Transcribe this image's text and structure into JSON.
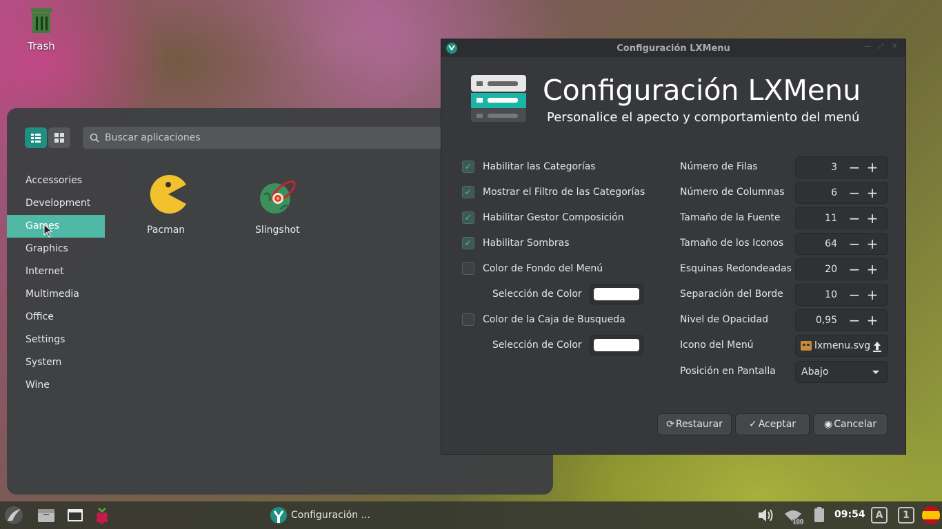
{
  "desktop": {
    "trash_label": "Trash"
  },
  "menu": {
    "search_placeholder": "Buscar aplicaciones",
    "categories": [
      "Accessories",
      "Development",
      "Games",
      "Graphics",
      "Internet",
      "Multimedia",
      "Office",
      "Settings",
      "System",
      "Wine"
    ],
    "active_category": "Games",
    "apps": [
      {
        "label": "Pacman",
        "icon": "pacman-icon"
      },
      {
        "label": "Slingshot",
        "icon": "slingshot-icon"
      }
    ]
  },
  "config_window": {
    "title": "Configuración LXMenu",
    "header_title": "Configuración LXMenu",
    "header_subtitle": "Personalice el apecto y comportamiento del menú",
    "checkboxes": [
      {
        "label": "Habilitar las Categorías",
        "checked": true
      },
      {
        "label": "Mostrar el Filtro de las Categorías",
        "checked": true
      },
      {
        "label": "Habilitar Gestor Composición",
        "checked": true
      },
      {
        "label": "Habilitar Sombras",
        "checked": true
      },
      {
        "label": "Color de Fondo del Menú",
        "checked": false
      },
      {
        "label": "Color de la Caja de Busqueda",
        "checked": false
      }
    ],
    "color_selection_label": "Selección de Color",
    "fields": [
      {
        "label": "Número de Filas",
        "value": "3"
      },
      {
        "label": "Número de Columnas",
        "value": "6"
      },
      {
        "label": "Tamaño de la Fuente",
        "value": "11"
      },
      {
        "label": "Tamaño de los Iconos",
        "value": "64"
      },
      {
        "label": "Esquinas Redondeadas",
        "value": "20"
      },
      {
        "label": "Separación del Borde",
        "value": "10"
      },
      {
        "label": "Nivel de Opacidad",
        "value": "0,95"
      }
    ],
    "menu_icon_label": "Icono del Menú",
    "menu_icon_file": "lxmenu.svg",
    "screen_position_label": "Posición en Pantalla",
    "screen_position_value": "Abajo",
    "buttons": {
      "restore": "Restaurar",
      "accept": "Aceptar",
      "cancel": "Cancelar"
    }
  },
  "taskbar": {
    "task_label": "Configuración ...",
    "clock": "09:54",
    "kbd_a": "A",
    "kbd_1": "1",
    "wifi_badge": "100"
  },
  "colors": {
    "accent": "#4fb9a5",
    "accent_dark": "#1e8f80",
    "power": "#e0383b"
  }
}
